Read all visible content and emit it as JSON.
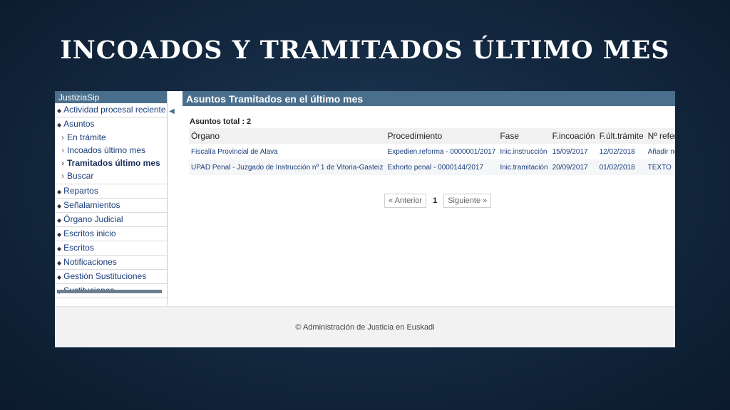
{
  "slide": {
    "title": "INCOADOS Y TRAMITADOS ÚLTIMO MES"
  },
  "sidebar": {
    "app_name": "JustiziaSip",
    "items": [
      {
        "label": "Actividad procesal reciente"
      },
      {
        "label": "Asuntos"
      },
      {
        "label": "Repartos"
      },
      {
        "label": "Señalamientos"
      },
      {
        "label": "Órgano Judicial"
      },
      {
        "label": "Escritos inicio"
      },
      {
        "label": "Escritos"
      },
      {
        "label": "Notificaciones"
      },
      {
        "label": "Gestión Sustituciones"
      },
      {
        "label": "Sustituciones"
      }
    ],
    "asuntos_sub": [
      {
        "label": "En trámite"
      },
      {
        "label": "Incoados último mes"
      },
      {
        "label": "Tramitados último mes"
      },
      {
        "label": "Buscar"
      }
    ]
  },
  "main": {
    "title": "Asuntos Tramitados en el último mes",
    "total_label": "Asuntos total : 2",
    "columns": [
      "Órgano",
      "Procedimiento",
      "Fase",
      "F.incoación",
      "F.últ.trámite",
      "Nº referencia"
    ],
    "rows": [
      [
        "Fiscalía Provincial de Alava",
        "Expedien.reforma - 0000001/2017",
        "Inic.instrucción",
        "15/09/2017",
        "12/02/2018",
        "Añadir número"
      ],
      [
        "UPAD Penal - Juzgado de Instrucción nº 1 de Vitoria-Gasteiz",
        "Exhorto penal - 0000144/2017",
        "Inic.tramitación",
        "20/09/2017",
        "01/02/2018",
        "TEXTO"
      ]
    ],
    "pager": {
      "prev": "« Anterior",
      "current": "1",
      "next": "Siguiente »"
    }
  },
  "footer": {
    "text": "© Administración de Justicia en Euskadi"
  }
}
